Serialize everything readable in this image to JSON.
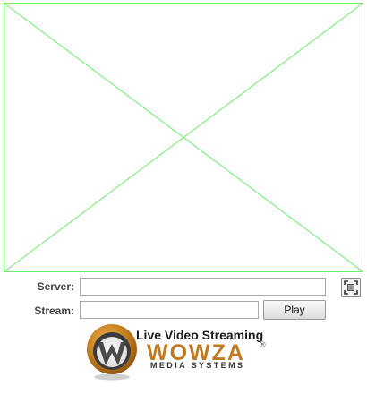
{
  "player": {
    "placeholder_color": "#66ee66"
  },
  "form": {
    "server_label": "Server:",
    "server_value": "",
    "stream_label": "Stream:",
    "stream_value": "",
    "play_label": "Play",
    "fullscreen_icon": "fullscreen-icon"
  },
  "logo": {
    "tagline": "Live Video Streaming",
    "brand": "WOWZA",
    "registered": "®",
    "sub": "MEDIA SYSTEMS",
    "brand_color": "#c27a1e"
  }
}
